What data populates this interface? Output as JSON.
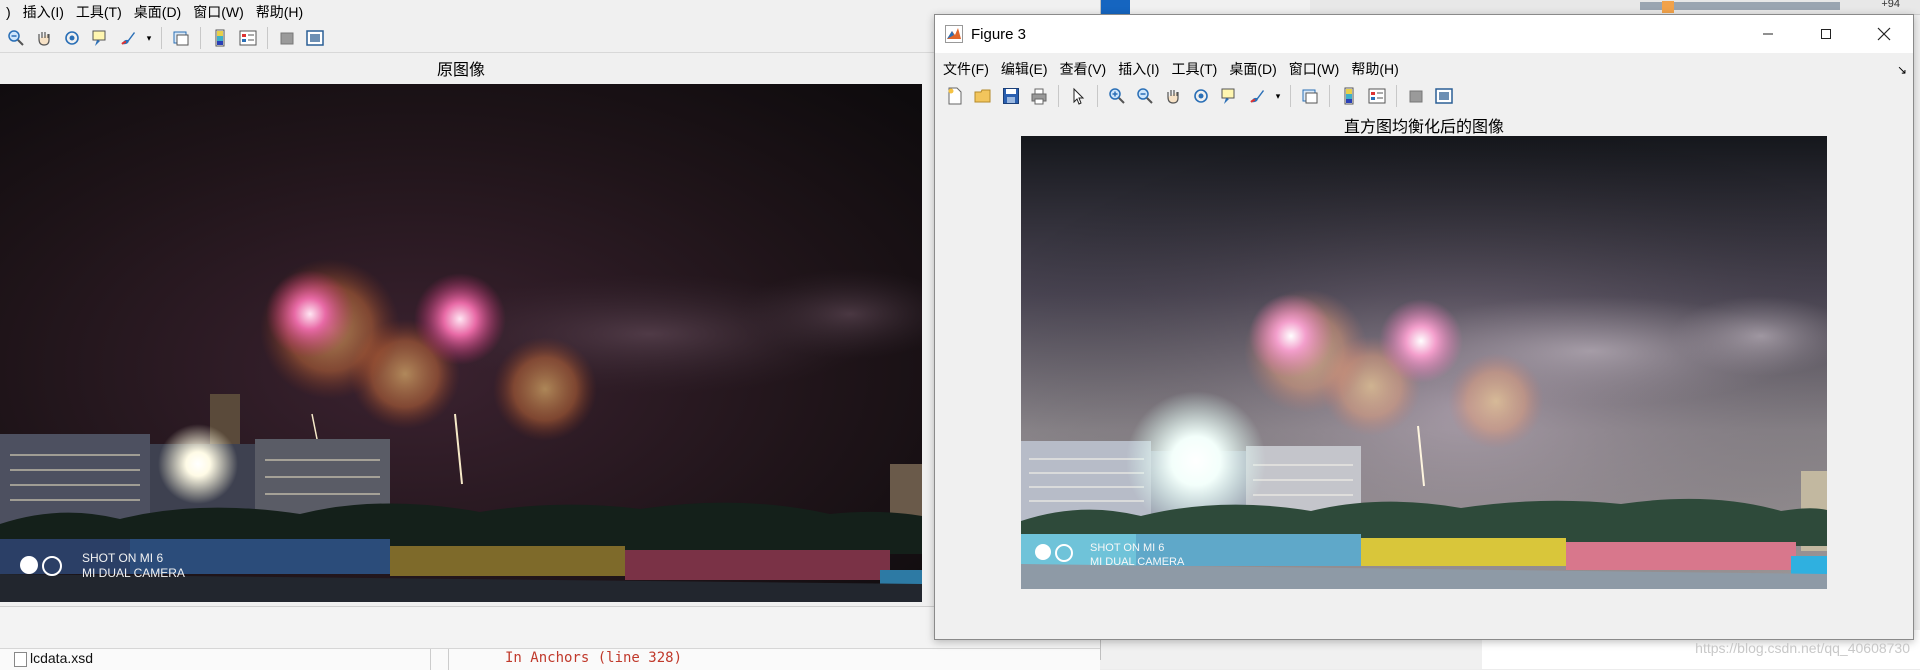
{
  "figure_left": {
    "menu": [
      "",
      "插入(I)",
      "工具(T)",
      "桌面(D)",
      "窗口(W)",
      "帮助(H)"
    ],
    "axes_title": "原图像",
    "photo_caption": {
      "line1": "SHOT ON MI 6",
      "line2": "MI DUAL CAMERA"
    }
  },
  "figure3": {
    "window_title": "Figure 3",
    "menu": [
      "文件(F)",
      "编辑(E)",
      "查看(V)",
      "插入(I)",
      "工具(T)",
      "桌面(D)",
      "窗口(W)",
      "帮助(H)"
    ],
    "axes_title": "直方图均衡化后的图像",
    "photo_caption": {
      "line1": "SHOT ON MI 6",
      "line2": "MI DUAL CAMERA"
    }
  },
  "background": {
    "file_name": "lcdata.xsd",
    "code_snippet": "In Anchors (line 328)",
    "top_right_text": "+94",
    "watermark": "https://blog.csdn.net/qq_40608730"
  },
  "colors": {
    "menu_bg": "#f0f0f0",
    "titlebar_bg": "#ffffff",
    "matlab_icon": "#e0662a",
    "code_text": "#c0392b"
  }
}
